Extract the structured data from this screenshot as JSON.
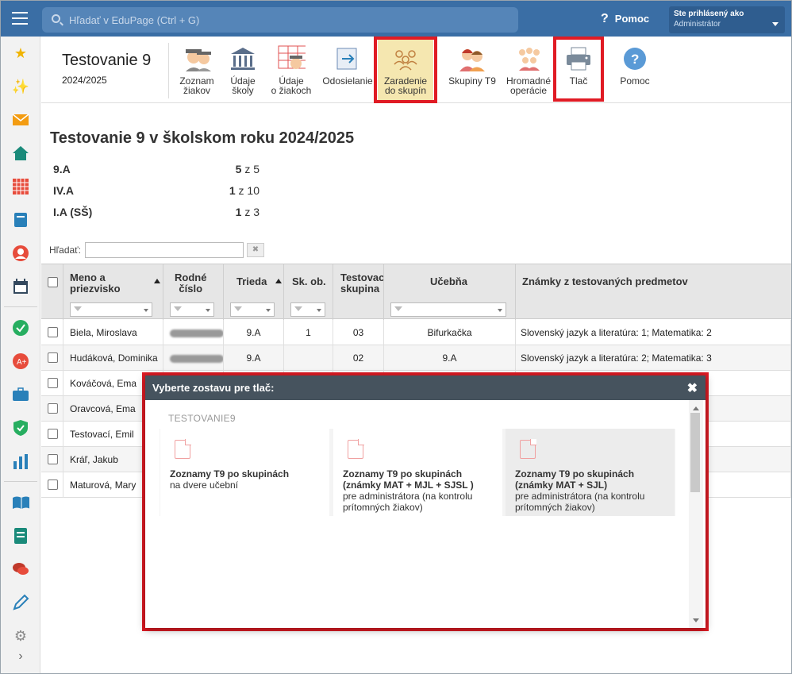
{
  "header": {
    "search_placeholder": "Hľadať v EduPage (Ctrl + G)",
    "help_label": "Pomoc",
    "login_line1": "Ste prihlásený ako",
    "login_line2": "Administrátor"
  },
  "toolbar": {
    "title": "Testovanie 9",
    "subtitle": "2024/2025",
    "buttons": [
      {
        "l1": "Zoznam",
        "l2": "žiakov"
      },
      {
        "l1": "Údaje",
        "l2": "školy"
      },
      {
        "l1": "Údaje",
        "l2": "o žiakoch"
      },
      {
        "l1": "Odosielanie",
        "l2": ""
      },
      {
        "l1": "Zaradenie",
        "l2": "do skupín"
      },
      {
        "l1": "Skupiny T9",
        "l2": ""
      },
      {
        "l1": "Hromadné",
        "l2": "operácie"
      },
      {
        "l1": "Tlač",
        "l2": ""
      },
      {
        "l1": "Pomoc",
        "l2": ""
      }
    ]
  },
  "main": {
    "heading": "Testovanie 9 v školskom roku 2024/2025",
    "classes": [
      {
        "name": "9.A",
        "count": "5",
        "of": "z 5"
      },
      {
        "name": "IV.A",
        "count": "1",
        "of": "z 10"
      },
      {
        "name": "I.A (SŠ)",
        "count": "1",
        "of": "z 3"
      }
    ],
    "filter_label": "Hľadať:",
    "clear_label": "✖"
  },
  "table": {
    "columns": [
      "Meno a priezvisko",
      "Rodné číslo",
      "Trieda",
      "Sk. ob.",
      "Testovacia skupina",
      "Učebňa",
      "Známky z testovaných predmetov"
    ],
    "col_lines": [
      [
        "Meno a",
        "priezvisko"
      ],
      [
        "Rodné",
        "číslo"
      ],
      [
        "Trieda",
        ""
      ],
      [
        "Sk. ob.",
        ""
      ],
      [
        "Testovac",
        "skupina"
      ],
      [
        "Učebňa",
        ""
      ],
      [
        "Známky z testovaných predmetov",
        ""
      ]
    ],
    "rows": [
      {
        "name": "Biela, Miroslava",
        "rc": "",
        "trieda": "9.A",
        "skob": "1",
        "skupina": "03",
        "ucebna": "Bifurkačka",
        "znamky": "Slovenský jazyk a literatúra: 1; Matematika: 2"
      },
      {
        "name": "Hudáková, Dominika",
        "rc": "",
        "trieda": "9.A",
        "skob": "",
        "skupina": "02",
        "ucebna": "9.A",
        "znamky": "Slovenský jazyk a literatúra: 2; Matematika: 3"
      },
      {
        "name": "Kováčová, Ema",
        "rc": "",
        "trieda": "",
        "skob": "",
        "skupina": "",
        "ucebna": "",
        "znamky": ""
      },
      {
        "name": "Oravcová, Ema",
        "rc": "",
        "trieda": "",
        "skob": "",
        "skupina": "",
        "ucebna": "",
        "znamky": ""
      },
      {
        "name": "Testovací, Emil",
        "rc": "",
        "trieda": "",
        "skob": "",
        "skupina": "",
        "ucebna": "",
        "znamky": ""
      },
      {
        "name": "Kráľ, Jakub",
        "rc": "",
        "trieda": "",
        "skob": "",
        "skupina": "",
        "ucebna": "",
        "znamky": ""
      },
      {
        "name": "Maturová, Mary",
        "rc": "",
        "trieda": "",
        "skob": "",
        "skupina": "",
        "ucebna": "",
        "znamky": ""
      }
    ]
  },
  "modal": {
    "title": "Vyberte zostavu pre tlač:",
    "close": "✖",
    "section": "TESTOVANIE9",
    "cards": [
      {
        "title1": "Zoznamy T9 po skupinách",
        "title2": "",
        "desc1": "na dvere učební",
        "desc2": ""
      },
      {
        "title1": "Zoznamy T9 po skupinách",
        "title2": "(známky MAT + MJL + SJSL )",
        "desc1": "pre administrátora (na kontrolu",
        "desc2": "prítomných žiakov)"
      },
      {
        "title1": "Zoznamy T9 po skupinách",
        "title2": "(známky MAT + SJL)",
        "desc1": "pre administrátora (na kontrolu",
        "desc2": "prítomných žiakov)"
      }
    ]
  },
  "colors": {
    "topbar": "#3a6ea5",
    "highlight": "#f5e7b0",
    "annotation": "#e01b24",
    "modal_header": "#46535e"
  }
}
